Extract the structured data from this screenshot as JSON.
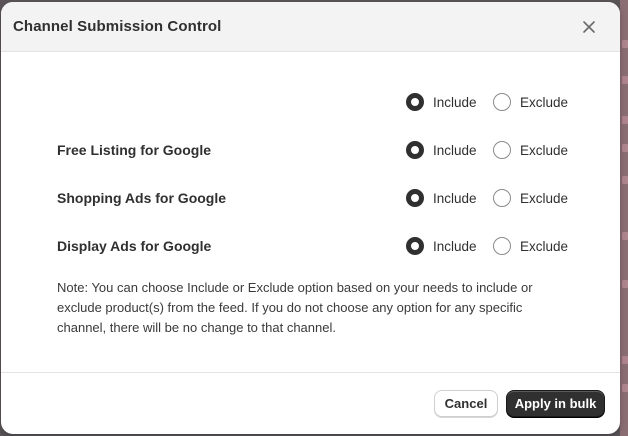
{
  "dialog": {
    "title": "Channel Submission Control",
    "close_icon": "close-icon"
  },
  "options": {
    "include": "Include",
    "exclude": "Exclude"
  },
  "rows": [
    {
      "label": "",
      "selected": "include"
    },
    {
      "label": "Free Listing for Google",
      "selected": "include"
    },
    {
      "label": "Shopping Ads for Google",
      "selected": "include"
    },
    {
      "label": "Display Ads for Google",
      "selected": "include"
    }
  ],
  "note": "Note: You can choose Include or Exclude option based on your needs to include or exclude product(s) from the feed. If you do not choose any option for any specific channel, there will be no change to that channel.",
  "footer": {
    "cancel_label": "Cancel",
    "apply_label": "Apply in bulk"
  },
  "colors": {
    "primary_button": "#303030",
    "header_background": "#f3f3f3"
  }
}
